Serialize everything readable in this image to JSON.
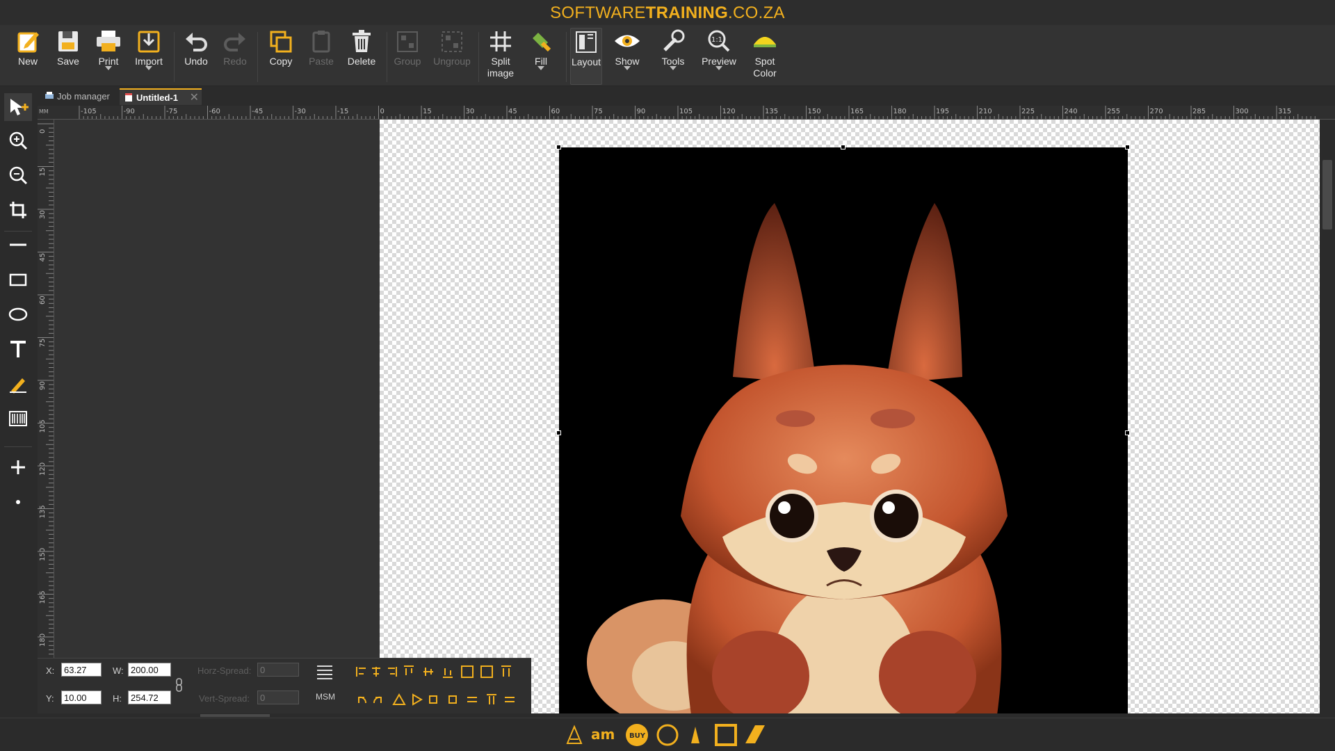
{
  "title": {
    "part1": "SOFTWARE",
    "part2": "TRAINING",
    "part3": ".CO.ZA"
  },
  "toolbar": {
    "new": "New",
    "save": "Save",
    "print": "Print",
    "import": "Import",
    "undo": "Undo",
    "redo": "Redo",
    "copy": "Copy",
    "paste": "Paste",
    "delete": "Delete",
    "group": "Group",
    "ungroup": "Ungroup",
    "split1": "Split",
    "split2": "image",
    "fill": "Fill",
    "layout": "Layout",
    "show": "Show",
    "tools": "Tools",
    "preview": "Preview",
    "spot1": "Spot",
    "spot2": "Color"
  },
  "tabs": [
    {
      "label": "Job manager"
    },
    {
      "label": "Untitled-1"
    }
  ],
  "ruler": {
    "unit": "MM",
    "h_labels": [
      "-105",
      "-90",
      "-75",
      "-60",
      "-45",
      "-30",
      "-15",
      "0",
      "15",
      "30",
      "45",
      "60",
      "75",
      "90",
      "105",
      "120",
      "135",
      "150",
      "165",
      "180",
      "195",
      "210",
      "225",
      "240",
      "255",
      "270",
      "285",
      "300",
      "315"
    ],
    "v_labels": [
      "0",
      "15",
      "30",
      "45",
      "60",
      "75",
      "90",
      "105",
      "120",
      "135",
      "150",
      "165",
      "180"
    ]
  },
  "props": {
    "x_label": "X:",
    "x_value": "63.27",
    "y_label": "Y:",
    "y_value": "10.00",
    "w_label": "W:",
    "w_value": "200.00",
    "h_label": "H:",
    "h_value": "254.72",
    "horz_label": "Horz-Spread:",
    "horz_value": "0",
    "vert_label": "Vert-Spread:",
    "vert_value": "0",
    "msm": "MSM"
  },
  "colors": {
    "accent": "#f2b01e",
    "toolbar_bg": "#333333",
    "canvas_bg": "#333333"
  }
}
